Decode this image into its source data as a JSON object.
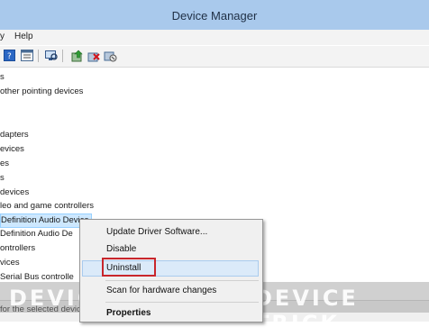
{
  "window": {
    "title": "Device Manager"
  },
  "menu": {
    "items": [
      "y",
      "Help"
    ]
  },
  "toolbar": {
    "buttons": [
      "help-icon",
      "properties-icon",
      "scan-icon",
      "update-driver-icon",
      "uninstall-icon",
      "disable-icon"
    ]
  },
  "tree": {
    "items": [
      "s",
      "other pointing devices",
      "",
      "",
      "dapters",
      "evices",
      "es",
      "s",
      "devices",
      "leo and game controllers",
      "Definition Audio Device",
      "Definition Audio De",
      "ontrollers",
      "vices",
      "Serial Bus controlle"
    ]
  },
  "context_menu": {
    "items": [
      "Update Driver Software...",
      "Disable",
      "Uninstall",
      "Scan for hardware changes",
      "Properties"
    ],
    "highlighted": "Uninstall"
  },
  "status_bar": {
    "text": "for the selected devic"
  },
  "watermark": {
    "left": "DEVICE TRICKS",
    "right": "DEVICE TRICK"
  },
  "colors": {
    "titlebar": "#a9c9ec",
    "highlight": "#c8262c",
    "selection": "#cde8ff"
  }
}
